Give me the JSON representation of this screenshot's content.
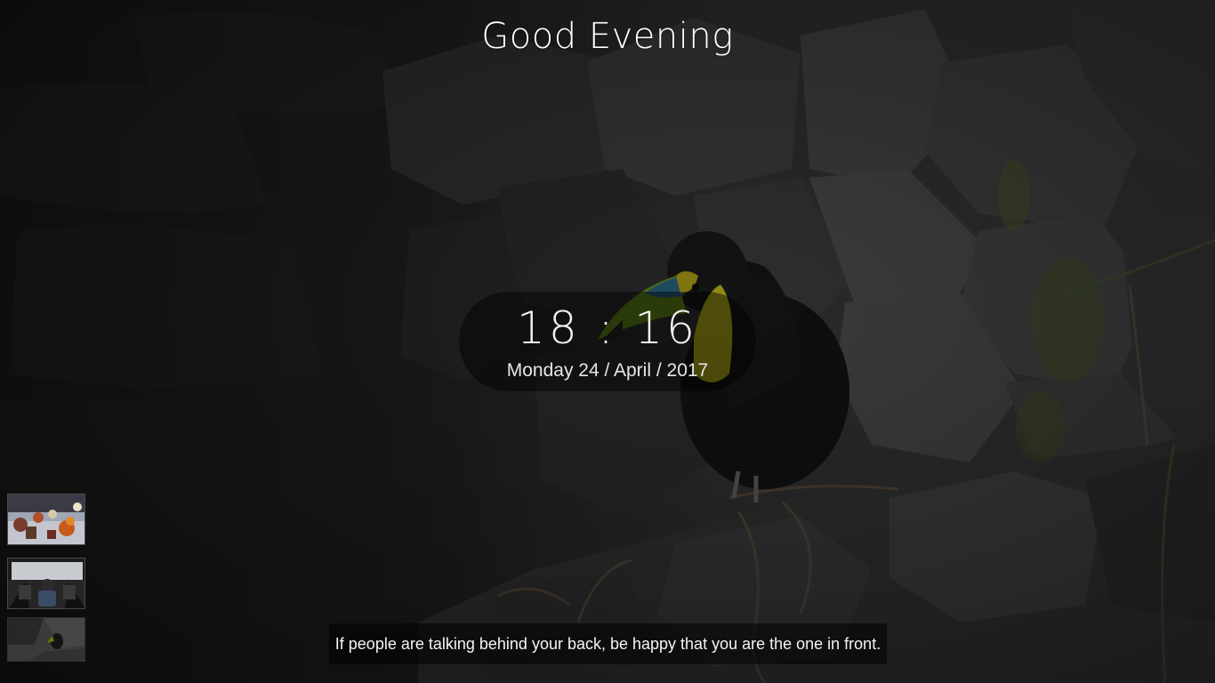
{
  "greeting": "Good Evening",
  "clock": {
    "time": "18 : 16",
    "date": "Monday 24 / April / 2017"
  },
  "quote": "If people are talking behind your back, be happy that you are the one in front.",
  "thumbnails": [
    {
      "icon": "festival-photo-thumbnail"
    },
    {
      "icon": "car-interior-photo-thumbnail"
    },
    {
      "icon": "toucan-photo-thumbnail"
    }
  ],
  "colors": {
    "overlay": "#000000",
    "text": "#ffffff",
    "toucan_beak_yellow": "#c8c81a",
    "toucan_beak_green": "#5e8a16"
  }
}
